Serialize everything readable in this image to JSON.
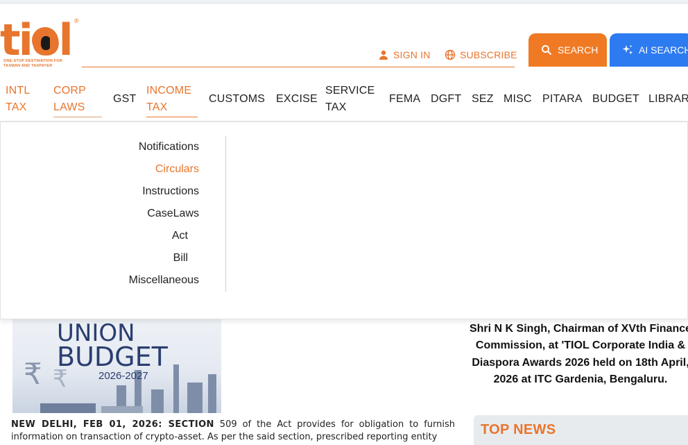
{
  "brand": {
    "logo_text": "tiol",
    "registered": "®",
    "tagline_1": "ONE-STOP DESTINATION FOR",
    "tagline_2": "TAXMAN AND TAXPAYER",
    "color": "#e8752d"
  },
  "header": {
    "sign_in": "SIGN IN",
    "subscribe": "SUBSCRIBE",
    "search_button": "SEARCH",
    "ai_search_button": "AI SEARCH"
  },
  "nav": {
    "items": [
      {
        "line1": "INTL",
        "line2": "TAX"
      },
      {
        "line1": "CORP",
        "line2": "LAWS"
      },
      {
        "line1": "GST",
        "line2": ""
      },
      {
        "line1": "INCOME",
        "line2": "TAX"
      },
      {
        "line1": "CUSTOMS",
        "line2": ""
      },
      {
        "line1": "EXCISE",
        "line2": ""
      },
      {
        "line1": "SERVICE",
        "line2": "TAX"
      },
      {
        "line1": "FEMA",
        "line2": ""
      },
      {
        "line1": "DGFT",
        "line2": ""
      },
      {
        "line1": "SEZ",
        "line2": ""
      },
      {
        "line1": "MISC",
        "line2": ""
      },
      {
        "line1": "PITARA",
        "line2": ""
      },
      {
        "line1": "BUDGET",
        "line2": ""
      },
      {
        "line1": "LIBRARY",
        "line2": ""
      }
    ]
  },
  "dropdown": {
    "items": [
      "Notifications",
      "Circulars",
      "Instructions",
      "CaseLaws",
      "Act",
      "Bill",
      "Miscellaneous"
    ],
    "active": "Circulars"
  },
  "banner": {
    "line1": "UNION",
    "line2": "BUDGET",
    "years": "2026-2027"
  },
  "article": {
    "dateline": "NEW DELHI, FEB 01, 2026: SECTION",
    "text": " 509 of the Act provides for obligation to furnish information on transaction of crypto-asset. As per the said section, prescribed reporting entity"
  },
  "caption": {
    "text": "Shri N K Singh, Chairman of XVth Finance Commission, at 'TIOL Corporate India & Diaspora Awards 2026 held on 18th April, 2026 at ITC Gardenia, Bengaluru."
  },
  "sidebar": {
    "top_news": "TOP NEWS"
  }
}
